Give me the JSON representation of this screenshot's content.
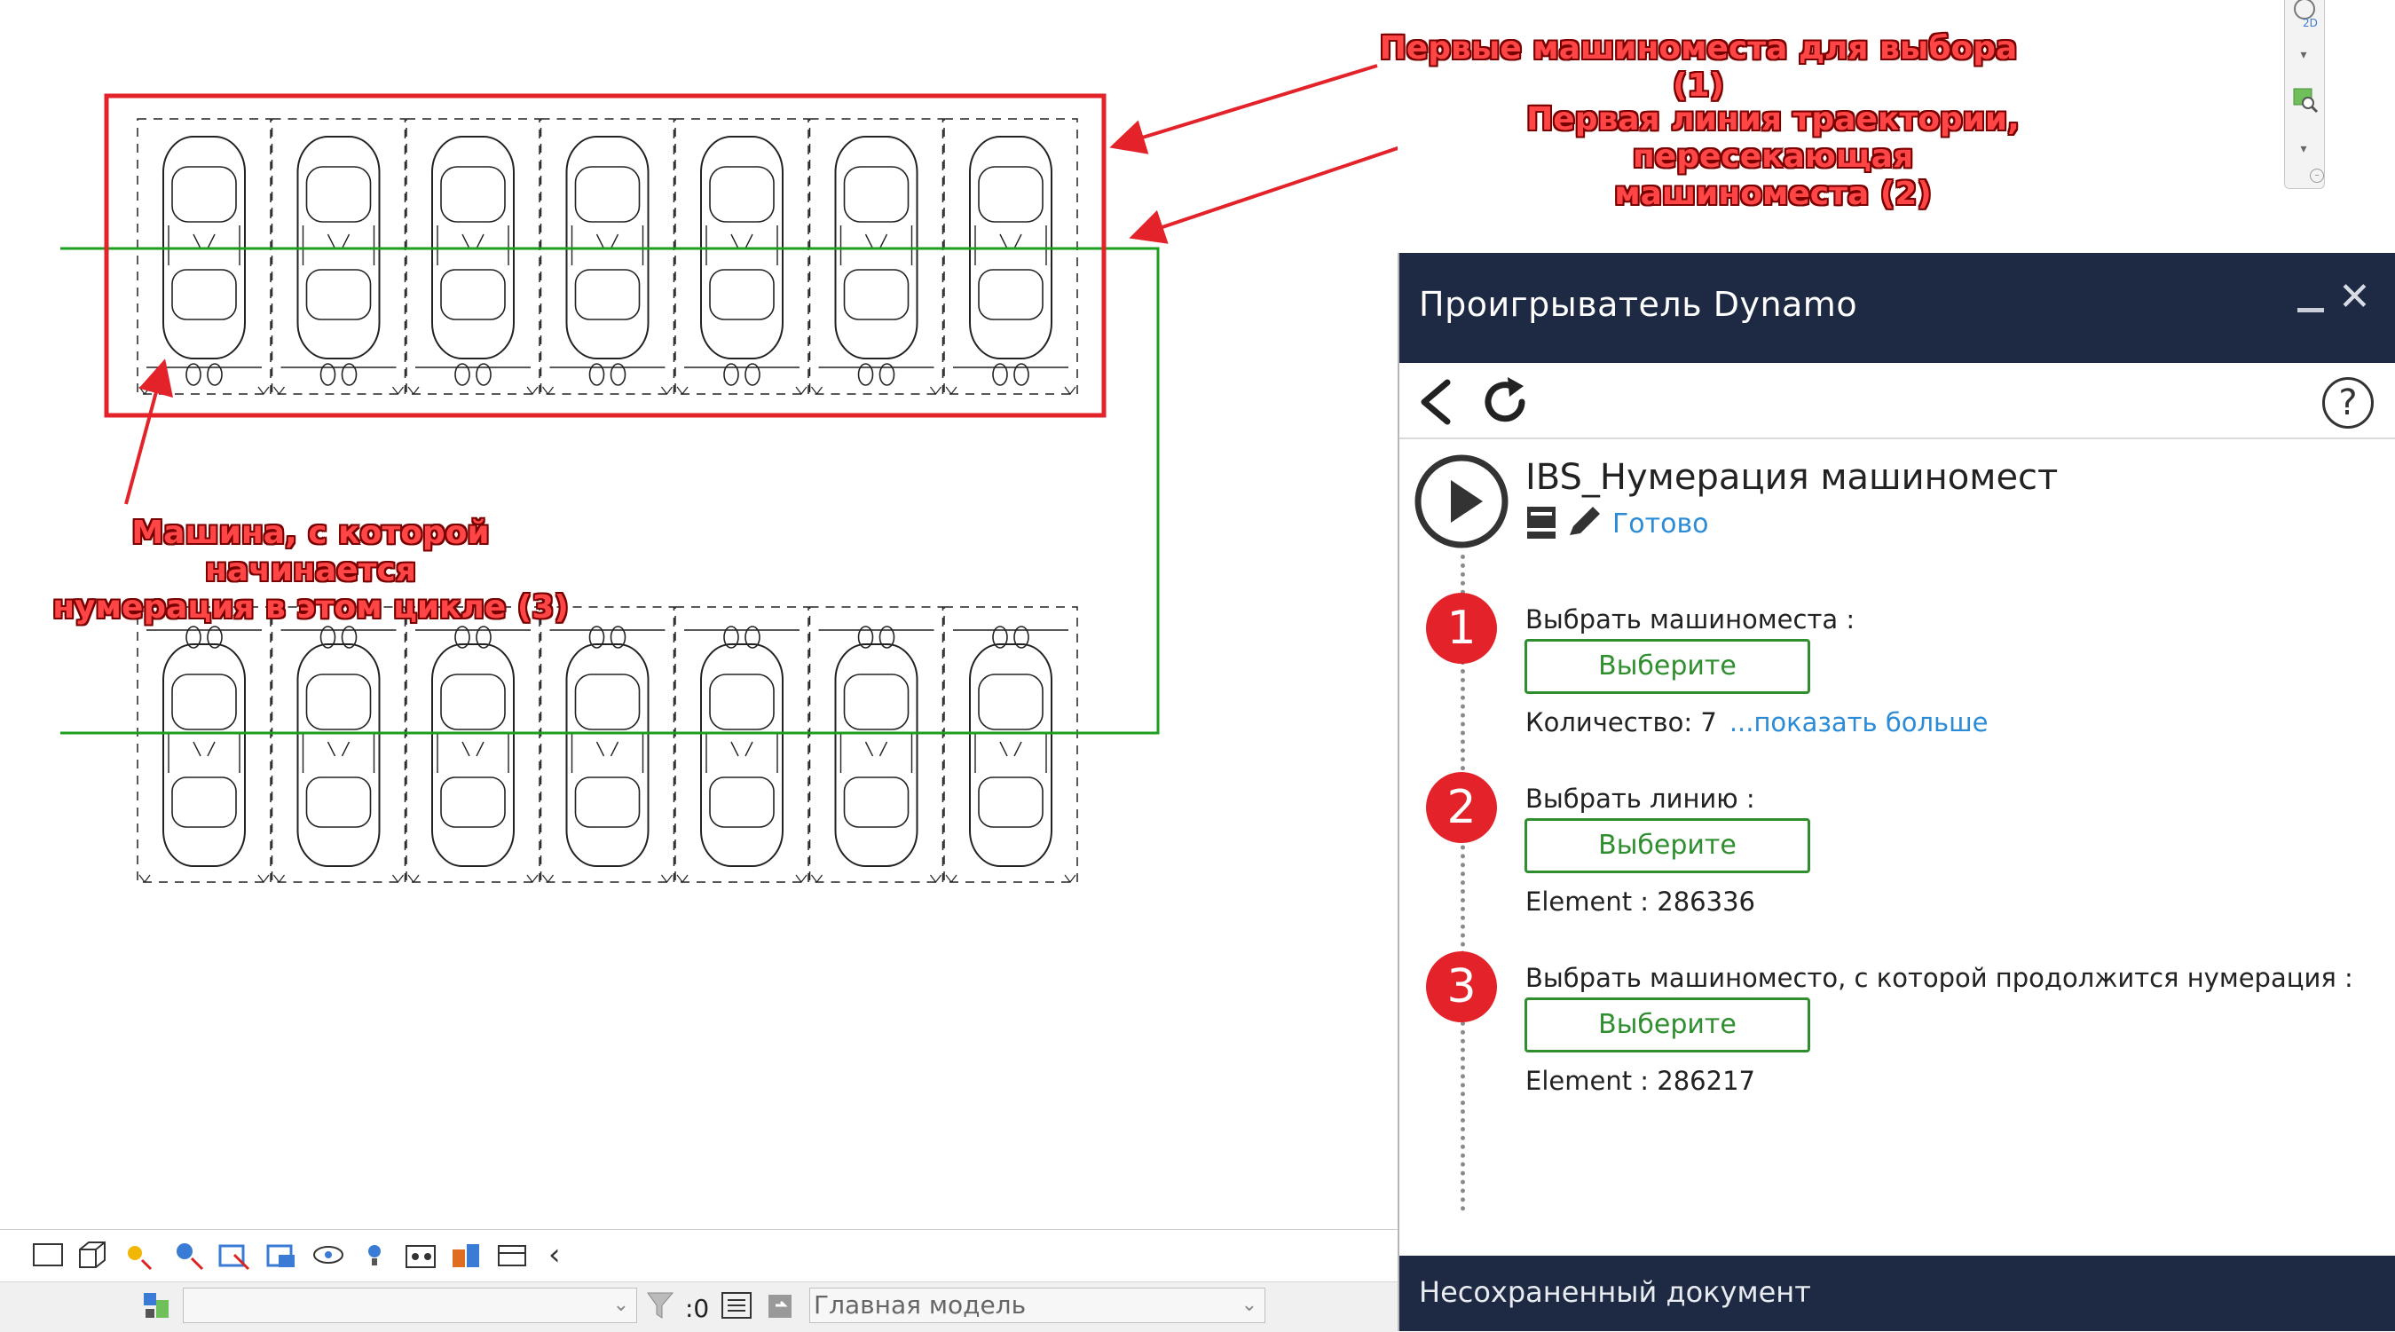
{
  "annotations": {
    "a1": "Первые машиноместа для выбора (1)",
    "a2_line1": "Первая линия траектории, пересекающая",
    "a2_line2": "машиноместа (2)",
    "a3_line1": "Машина, с которой начинается",
    "a3_line2": "нумерация в этом цикле (3)"
  },
  "drawing": {
    "rows": 2,
    "cars_per_row": 7,
    "colors": {
      "selection": "#e3222a",
      "trajectory": "#1e9e1e",
      "annotation": "#ff4545"
    }
  },
  "dynamo": {
    "title": "Проигрыватель Dynamo",
    "script_name": "IBS_Нумерация машиномест",
    "status": "Готово",
    "steps": [
      {
        "number": "1",
        "label": "Выбрать машиноместа :",
        "button": "Выберите",
        "info": "Количество: 7",
        "more": "...показать больше"
      },
      {
        "number": "2",
        "label": "Выбрать линию :",
        "button": "Выберите",
        "info": "Element : 286336"
      },
      {
        "number": "3",
        "label": "Выбрать машиноместо, с которой продолжится нумерация :",
        "button": "Выберите",
        "info": "Element : 286217"
      }
    ],
    "footer": "Несохраненный документ",
    "colors": {
      "header": "#1e2a44",
      "badge": "#e3222a",
      "button": "#2f8f2f",
      "link": "#2b8bd6"
    }
  },
  "viewbar": {
    "workset_value": "",
    "zero_label": ":0",
    "model_value": "Главная модель"
  },
  "navbar": {
    "badge": "2D"
  }
}
